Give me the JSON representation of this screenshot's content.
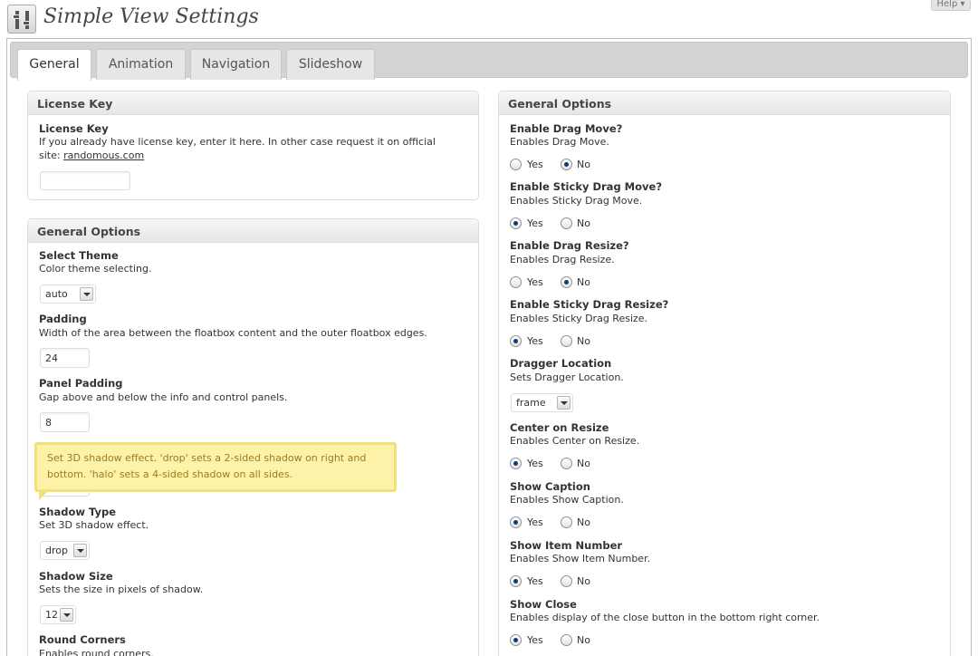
{
  "header": {
    "title": "Simple View Settings",
    "help_label": "Help ▾",
    "icon": "settings-sliders-icon"
  },
  "tabs": [
    {
      "label": "General",
      "active": true
    },
    {
      "label": "Animation",
      "active": false
    },
    {
      "label": "Navigation",
      "active": false
    },
    {
      "label": "Slideshow",
      "active": false
    }
  ],
  "license": {
    "box_title": "License Key",
    "label": "License Key",
    "desc_text": "If you already have license key, enter it here. In other case request it on official",
    "desc_site_prefix": "site: ",
    "site_link": "randomous.com",
    "value": ""
  },
  "left_options": {
    "box_title": "General Options",
    "theme": {
      "label": "Select Theme",
      "desc": "Color theme selecting.",
      "value": "auto"
    },
    "padding": {
      "label": "Padding",
      "desc": "Width of the area between the floatbox content and the outer floatbox edges.",
      "value": "24"
    },
    "panel_padding": {
      "label": "Panel Padding",
      "desc": "Gap above and below the info and control panels.",
      "value": "8"
    },
    "shadow_type": {
      "label": "Shadow Type",
      "desc": "Set 3D shadow effect.",
      "value": "drop"
    },
    "shadow_size": {
      "label": "Shadow Size",
      "desc": "Sets the size in pixels of shadow.",
      "value": "12"
    },
    "round_corners": {
      "label": "Round Corners",
      "desc": "Enables round corners."
    }
  },
  "tooltip": {
    "line1": "Set 3D shadow effect. 'drop' sets a 2-sided shadow on right and",
    "line2": "bottom. 'halo' sets a 4-sided shadow on all sides."
  },
  "right_options": {
    "box_title": "General Options",
    "yes_label": "Yes",
    "no_label": "No",
    "drag_move": {
      "label": "Enable Drag Move?",
      "desc": "Enables Drag Move.",
      "value": "No"
    },
    "sticky_drag_move": {
      "label": "Enable Sticky Drag Move?",
      "desc": "Enables Sticky Drag Move.",
      "value": "Yes"
    },
    "drag_resize": {
      "label": "Enable Drag Resize?",
      "desc": "Enables Drag Resize.",
      "value": "No"
    },
    "sticky_drag_resize": {
      "label": "Enable Sticky Drag Resize?",
      "desc": "Enables Sticky Drag Resize.",
      "value": "Yes"
    },
    "dragger_location": {
      "label": "Dragger Location",
      "desc": "Sets Dragger Location.",
      "value": "frame"
    },
    "center_on_resize": {
      "label": "Center on Resize",
      "desc": "Enables Center on Resize.",
      "value": "Yes"
    },
    "show_caption": {
      "label": "Show Caption",
      "desc": "Enables Show Caption.",
      "value": "Yes"
    },
    "show_item_number": {
      "label": "Show Item Number",
      "desc": "Enables Show Item Number.",
      "value": "Yes"
    },
    "show_close": {
      "label": "Show Close",
      "desc": "Enables display of the close button in the bottom right corner.",
      "value": "Yes"
    }
  }
}
